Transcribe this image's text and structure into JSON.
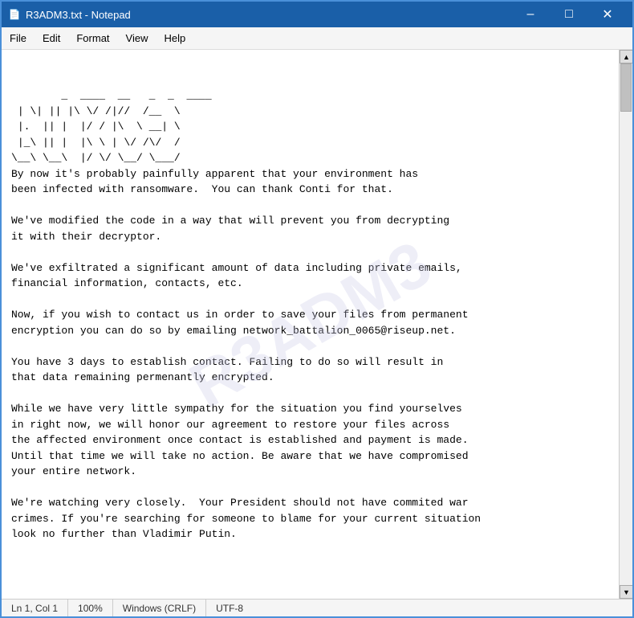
{
  "titleBar": {
    "icon": "📄",
    "title": "R3ADM3.txt - Notepad",
    "minimizeLabel": "–",
    "maximizeLabel": "□",
    "closeLabel": "✕"
  },
  "menuBar": {
    "items": [
      "File",
      "Edit",
      "Format",
      "View",
      "Help"
    ]
  },
  "content": {
    "ascii_art": "  _  ____  __   _  _  ____ \n | \\| || |\\ \\/ /|//  /__  \\\n |.  || |  |/ / |\\  \\ __| \\\n |_\\ || |  |\\ \\ | \\/ /\\/  /\n\\__\\ \\__\\  |/ \\/ \\__/ \\___/",
    "body": "\nBy now it's probably painfully apparent that your environment has\nbeen infected with ransomware.  You can thank Conti for that.\n\nWe've modified the code in a way that will prevent you from decrypting\nit with their decryptor.\n\nWe've exfiltrated a significant amount of data including private emails,\nfinancial information, contacts, etc.\n\nNow, if you wish to contact us in order to save your files from permanent\nencryption you can do so by emailing network_battalion_0065@riseup.net.\n\nYou have 3 days to establish contact. Failing to do so will result in\nthat data remaining permenantly encrypted.\n\nWhile we have very little sympathy for the situation you find yourselves\nin right now, we will honor our agreement to restore your files across\nthe affected environment once contact is established and payment is made.\nUntil that time we will take no action. Be aware that we have compromised\nyour entire network.\n\nWe're watching very closely.  Your President should not have commited war\ncrimes. If you're searching for someone to blame for your current situation\nlook no further than Vladimir Putin."
  },
  "statusBar": {
    "position": "Ln 1, Col 1",
    "zoom": "100%",
    "lineEnding": "Windows (CRLF)",
    "encoding": "UTF-8"
  },
  "watermark": {
    "text": "R3ADM3"
  }
}
